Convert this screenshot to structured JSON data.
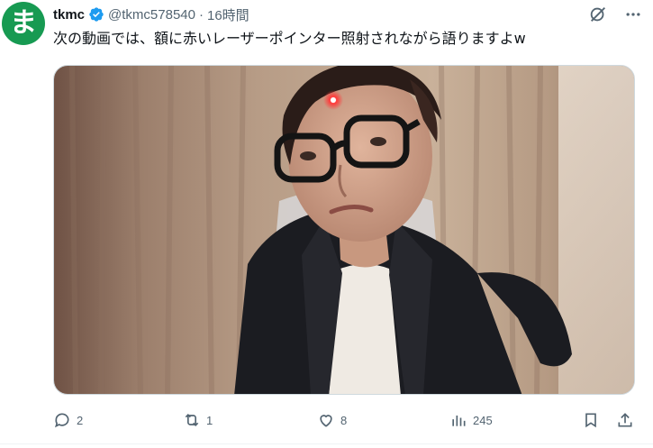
{
  "avatar": {
    "glyph": "ま",
    "color": "#179a52"
  },
  "author": {
    "display_name": "tkmc",
    "handle": "@tkmc578540",
    "separator": "·",
    "time_ago": "16時間",
    "verified_color": "#1d9bf0"
  },
  "header_icons": [
    "grok-icon",
    "more-icon"
  ],
  "tweet": {
    "text": "次の動画では、額に赤いレーザーポインター照射されながら語りますよw"
  },
  "media": {
    "type": "video-still"
  },
  "actions": {
    "reply_count": "2",
    "retweet_count": "1",
    "like_count": "8",
    "view_count": "245"
  },
  "colors": {
    "text_secondary": "#536471",
    "text_primary": "#0f1419"
  }
}
